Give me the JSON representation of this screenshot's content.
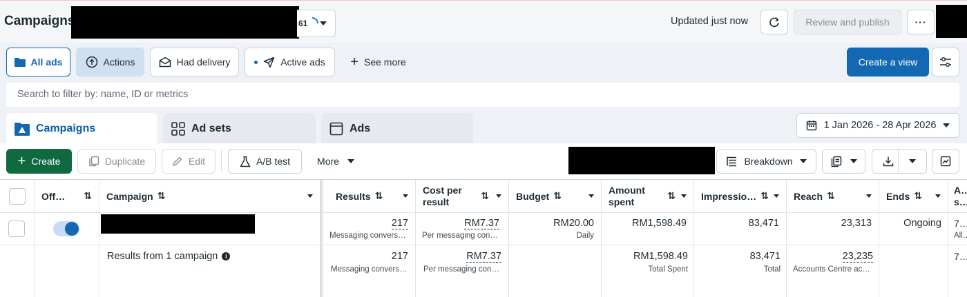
{
  "header": {
    "title": "Campaigns",
    "count_badge": "61",
    "updated_text": "Updated just now",
    "review_publish_label": "Review and publish",
    "more_label": "···"
  },
  "filters": {
    "all_ads": "All ads",
    "actions": "Actions",
    "had_delivery": "Had delivery",
    "active_ads": "Active ads",
    "see_more": "See more",
    "create_view": "Create a view"
  },
  "search": {
    "placeholder": "Search to filter by: name, ID or metrics"
  },
  "tabs": [
    {
      "label": "Campaigns"
    },
    {
      "label": "Ad sets"
    },
    {
      "label": "Ads"
    }
  ],
  "date_range": "1 Jan 2026 - 28 Apr 2026",
  "toolbar": {
    "create": "Create",
    "duplicate": "Duplicate",
    "edit": "Edit",
    "ab_test": "A/B test",
    "more": "More",
    "breakdown": "Breakdown"
  },
  "table": {
    "headers": {
      "offon": "Off…",
      "campaign": "Campaign",
      "results": "Results",
      "cost_per_result_1": "Cost per",
      "cost_per_result_2": "result",
      "budget": "Budget",
      "amount_spent_1": "Amount",
      "amount_spent_2": "spent",
      "impressions": "Impressio…",
      "reach": "Reach",
      "ends": "Ends",
      "attribution_1": "A…",
      "attribution_2": "s…"
    },
    "row": {
      "results": "217",
      "results_sub": "Messaging convers…",
      "cost": "RM7.37",
      "cost_sub": "Per messaging con…",
      "budget": "RM20.00",
      "budget_sub": "Daily",
      "amount": "RM1,598.49",
      "impressions": "83,471",
      "reach": "23,313",
      "ends": "Ongoing",
      "attr": "7…",
      "attr_sub": "All…"
    },
    "summary": {
      "label": "Results from 1 campaign",
      "results": "217",
      "results_sub": "Messaging convers…",
      "cost": "RM7.37",
      "cost_sub": "Per messaging con…",
      "amount": "RM1,598.49",
      "amount_sub": "Total Spent",
      "impressions": "83,471",
      "impressions_sub": "Total",
      "reach": "23,235",
      "reach_sub": "Accounts Centre ac…",
      "attr": "7…"
    }
  },
  "colors": {
    "primary_blue": "#1268b3",
    "create_green": "#0f6b3f",
    "toggle_blue": "#1877f2"
  }
}
